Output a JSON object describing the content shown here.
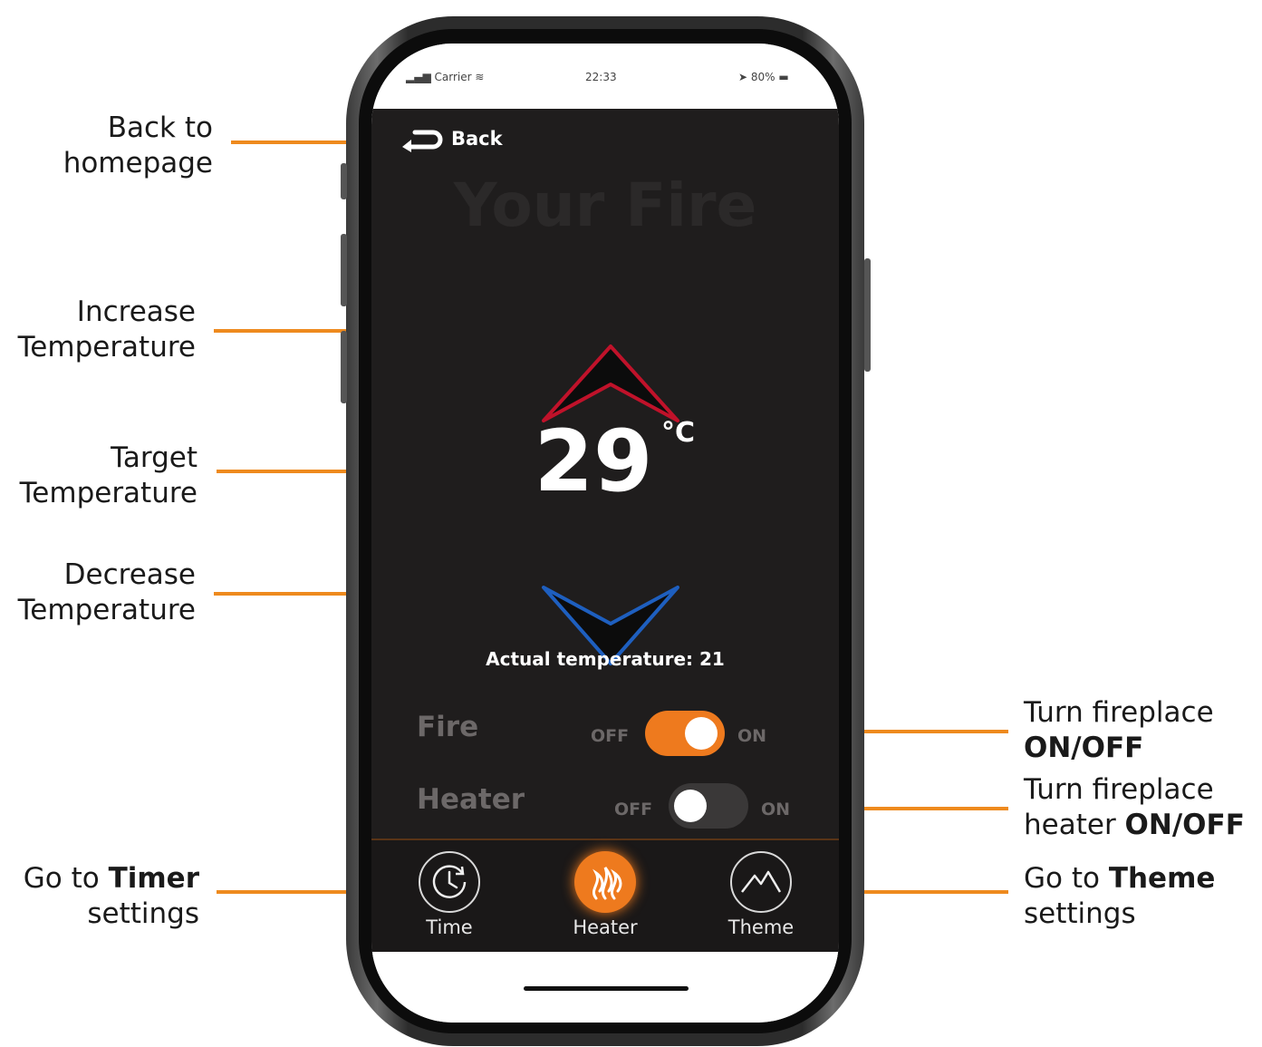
{
  "callouts": {
    "back": [
      "Back to",
      "homepage"
    ],
    "increase": [
      "Increase",
      "Temperature"
    ],
    "target": [
      "Target",
      "Temperature"
    ],
    "decrease": [
      "Decrease",
      "Temperature"
    ],
    "fire_toggle": {
      "line1": "Turn fireplace",
      "line2_bold": "ON/OFF"
    },
    "heater_toggle": {
      "line1": "Turn fireplace",
      "line2_prefix": "heater ",
      "line2_bold": "ON/OFF"
    },
    "timer": {
      "prefix": "Go to ",
      "bold": "Timer",
      "line2": "settings"
    },
    "theme": {
      "prefix": "Go to ",
      "bold": "Theme",
      "line2": "settings"
    }
  },
  "status_bar": {
    "carrier": "Carrier",
    "time": "22:33",
    "battery": "80%"
  },
  "app": {
    "back_label": "Back",
    "title": "Your Fire",
    "target_temperature": "29",
    "unit": "°C",
    "actual_temperature_text": "Actual temperature: 21",
    "rows": {
      "fire": {
        "label": "Fire",
        "off": "OFF",
        "on": "ON",
        "state": "on"
      },
      "heater": {
        "label": "Heater",
        "off": "OFF",
        "on": "ON",
        "state": "off"
      }
    },
    "tabs": [
      {
        "label": "Time",
        "icon": "clock-icon"
      },
      {
        "label": "Heater",
        "icon": "flame-icon",
        "active": true
      },
      {
        "label": "Theme",
        "icon": "mountain-icon"
      }
    ]
  },
  "colors": {
    "accent": "#ee7a1e",
    "leader": "#ee8a1e",
    "screen_bg": "#1f1d1d",
    "increase": "#c0122a",
    "decrease": "#1e5fbf"
  }
}
